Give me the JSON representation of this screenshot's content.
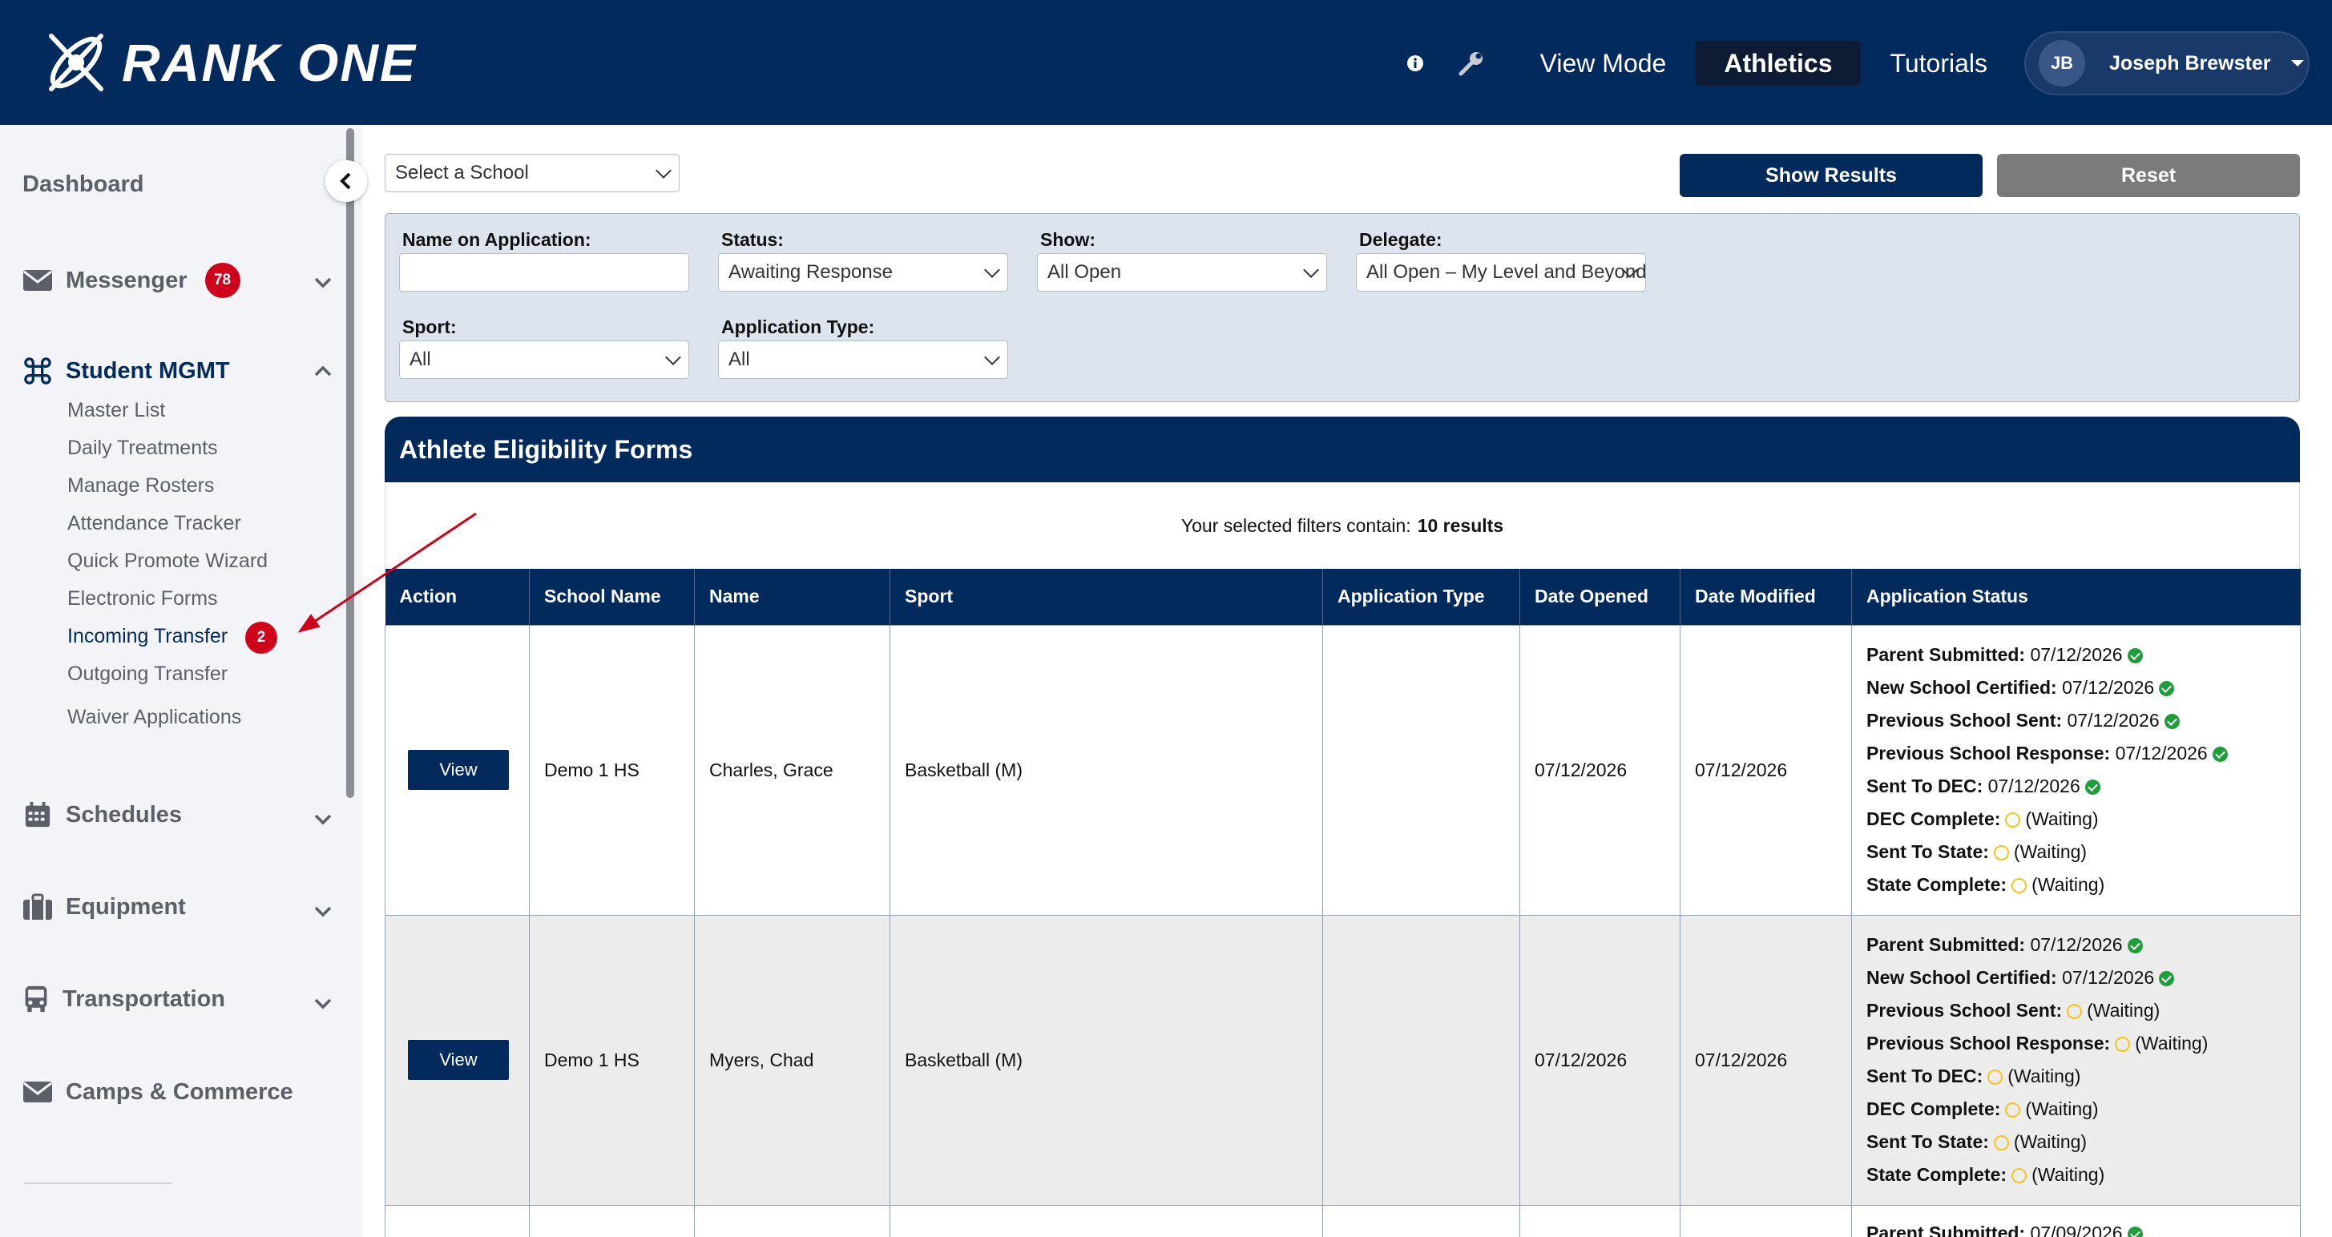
{
  "brand": {
    "name": "RANK ONE"
  },
  "topnav": {
    "view_mode": "View Mode",
    "athletics": "Athletics",
    "tutorials": "Tutorials",
    "user_initials": "JB",
    "user_name": "Joseph Brewster"
  },
  "sidebar": {
    "dashboard": "Dashboard",
    "messenger": {
      "label": "Messenger",
      "badge": "78"
    },
    "student_mgmt": {
      "label": "Student MGMT",
      "items": [
        {
          "label": "Master List"
        },
        {
          "label": "Daily Treatments"
        },
        {
          "label": "Manage Rosters"
        },
        {
          "label": "Attendance Tracker"
        },
        {
          "label": "Quick Promote Wizard"
        },
        {
          "label": "Electronic Forms"
        },
        {
          "label": "Incoming Transfer",
          "badge": "2"
        },
        {
          "label": "Outgoing Transfer"
        },
        {
          "label": "Waiver Applications"
        }
      ]
    },
    "schedules": "Schedules",
    "equipment": "Equipment",
    "transportation": "Transportation",
    "camps": "Camps & Commerce"
  },
  "toolbar": {
    "school_select": "Select a School",
    "show_results": "Show Results",
    "reset": "Reset"
  },
  "filters": {
    "name_label": "Name on Application:",
    "name_value": "",
    "status_label": "Status:",
    "status_value": "Awaiting Response",
    "show_label": "Show:",
    "show_value": "All Open",
    "delegate_label": "Delegate:",
    "delegate_value": "All Open – My Level and Beyond",
    "sport_label": "Sport:",
    "sport_value": "All",
    "apptype_label": "Application Type:",
    "apptype_value": "All"
  },
  "forms": {
    "title": "Athlete Eligibility Forms",
    "results_prefix": "Your selected filters contain:",
    "results_count": "10 results"
  },
  "table": {
    "headers": [
      "Action",
      "School Name",
      "Name",
      "Sport",
      "Application Type",
      "Date Opened",
      "Date Modified",
      "Application Status"
    ],
    "view_label": "View",
    "rows": [
      {
        "school": "Demo 1 HS",
        "name": "Charles, Grace",
        "sport": "Basketball (M)",
        "app_type": "",
        "opened": "07/12/2026",
        "modified": "07/12/2026",
        "status": [
          {
            "label": "Parent Submitted:",
            "value": "07/12/2026",
            "state": "ok"
          },
          {
            "label": "New School Certified:",
            "value": "07/12/2026",
            "state": "ok"
          },
          {
            "label": "Previous School Sent:",
            "value": "07/12/2026",
            "state": "ok"
          },
          {
            "label": "Previous School Response:",
            "value": "07/12/2026",
            "state": "ok"
          },
          {
            "label": "Sent To DEC:",
            "value": "07/12/2026",
            "state": "ok"
          },
          {
            "label": "DEC Complete:",
            "value": "(Waiting)",
            "state": "wait"
          },
          {
            "label": "Sent To State:",
            "value": "(Waiting)",
            "state": "wait"
          },
          {
            "label": "State Complete:",
            "value": "(Waiting)",
            "state": "wait"
          }
        ]
      },
      {
        "school": "Demo 1 HS",
        "name": "Myers, Chad",
        "sport": "Basketball (M)",
        "app_type": "",
        "opened": "07/12/2026",
        "modified": "07/12/2026",
        "status": [
          {
            "label": "Parent Submitted:",
            "value": "07/12/2026",
            "state": "ok"
          },
          {
            "label": "New School Certified:",
            "value": "07/12/2026",
            "state": "ok"
          },
          {
            "label": "Previous School Sent:",
            "value": "(Waiting)",
            "state": "wait"
          },
          {
            "label": "Previous School Response:",
            "value": "(Waiting)",
            "state": "wait"
          },
          {
            "label": "Sent To DEC:",
            "value": "(Waiting)",
            "state": "wait"
          },
          {
            "label": "DEC Complete:",
            "value": "(Waiting)",
            "state": "wait"
          },
          {
            "label": "Sent To State:",
            "value": "(Waiting)",
            "state": "wait"
          },
          {
            "label": "State Complete:",
            "value": "(Waiting)",
            "state": "wait"
          }
        ]
      },
      {
        "school": "",
        "name": "",
        "sport": "",
        "app_type": "",
        "opened": "",
        "modified": "",
        "status": [
          {
            "label": "Parent Submitted:",
            "value": "07/09/2026",
            "state": "ok"
          }
        ]
      }
    ]
  },
  "colors": {
    "navy": "#022a5c",
    "badge_red": "#d0021b",
    "ok_green": "#1e9e3b",
    "wait_yellow": "#f5c518",
    "annotation_red": "#d0021b"
  },
  "icons": [
    "logo-mark",
    "info-icon",
    "wrench-icon",
    "envelope-icon",
    "command-icon",
    "calendar-icon",
    "briefcase-icon",
    "bus-icon",
    "chevron-down-icon",
    "chevron-up-icon",
    "chevron-left-icon",
    "check-circle-icon",
    "waiting-circle-icon"
  ]
}
